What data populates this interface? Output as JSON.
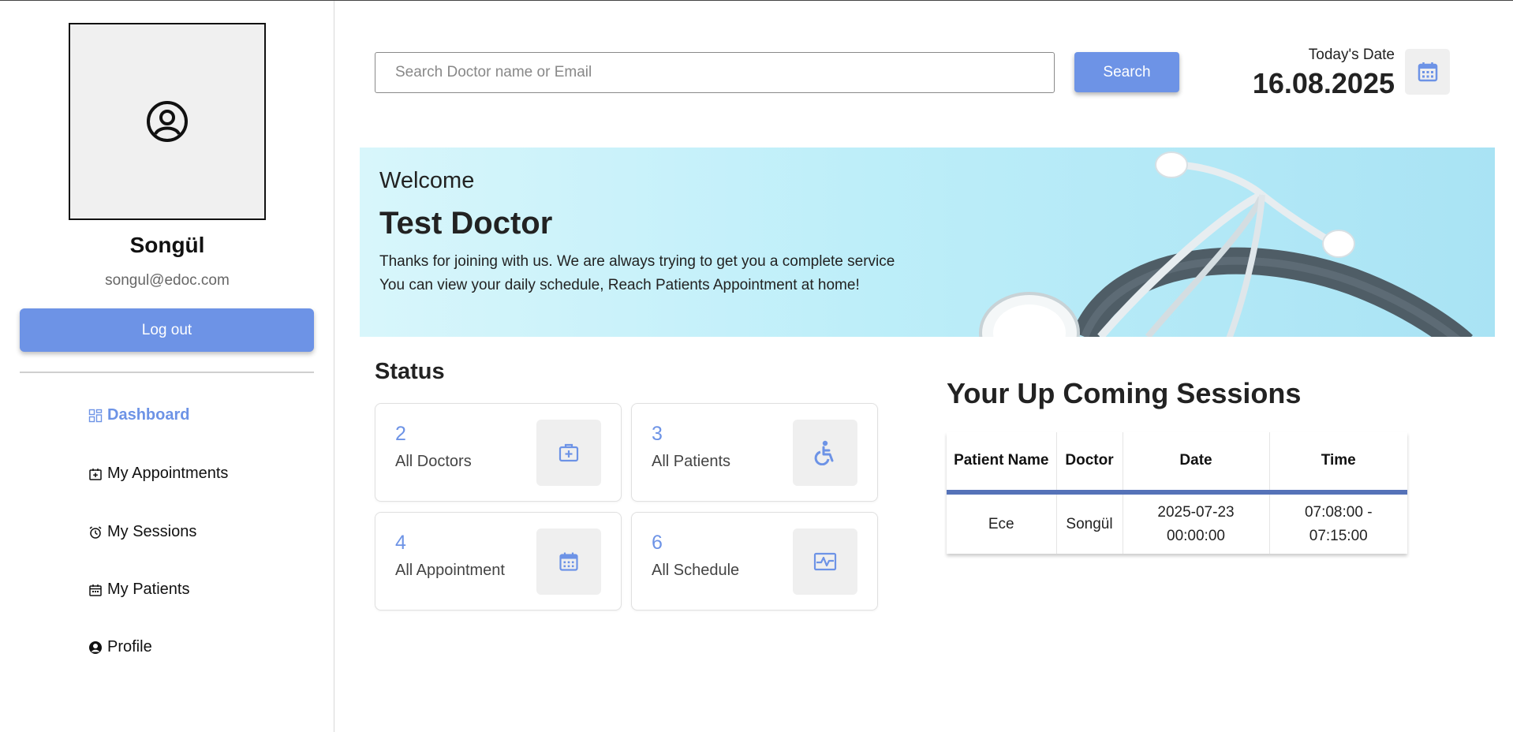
{
  "user": {
    "name": "Songül",
    "email": "songul@edoc.com",
    "logout_label": "Log out"
  },
  "nav": {
    "items": [
      {
        "label": "Dashboard",
        "icon": "dashboard-icon",
        "active": true
      },
      {
        "label": "My Appointments",
        "icon": "calendar-plus-icon",
        "active": false
      },
      {
        "label": "My Sessions",
        "icon": "alarm-clock-icon",
        "active": false
      },
      {
        "label": "My Patients",
        "icon": "calendar-icon",
        "active": false
      },
      {
        "label": "Profile",
        "icon": "user-circle-icon",
        "active": false
      }
    ]
  },
  "header": {
    "search_placeholder": "Search Doctor name or Email",
    "search_value": "",
    "search_label": "Search",
    "date_label": "Today's Date",
    "date_value": "16.08.2025"
  },
  "banner": {
    "welcome": "Welcome",
    "doctor_name": "Test Doctor",
    "line1": "Thanks for joining with us. We are always trying to get you a complete service",
    "line2": "You can view your daily schedule, Reach Patients Appointment at home!"
  },
  "status": {
    "title": "Status",
    "cards": [
      {
        "value": "2",
        "label": "All Doctors",
        "icon": "medical-kit-icon"
      },
      {
        "value": "3",
        "label": "All Patients",
        "icon": "wheelchair-icon"
      },
      {
        "value": "4",
        "label": "All Appointment",
        "icon": "calendar-icon"
      },
      {
        "value": "6",
        "label": "All Schedule",
        "icon": "heartbeat-icon"
      }
    ]
  },
  "sessions": {
    "title": "Your Up Coming Sessions",
    "columns": [
      "Patient Name",
      "Doctor",
      "Date",
      "Time"
    ],
    "rows": [
      {
        "patient": "Ece",
        "doctor": "Songül",
        "date": "2025-07-23 00:00:00",
        "time": "07:08:00 - 07:15:00"
      }
    ]
  },
  "colors": {
    "accent": "#6d93e6",
    "table_header_border": "#5572b8",
    "banner_bg": "#bdeef9"
  }
}
